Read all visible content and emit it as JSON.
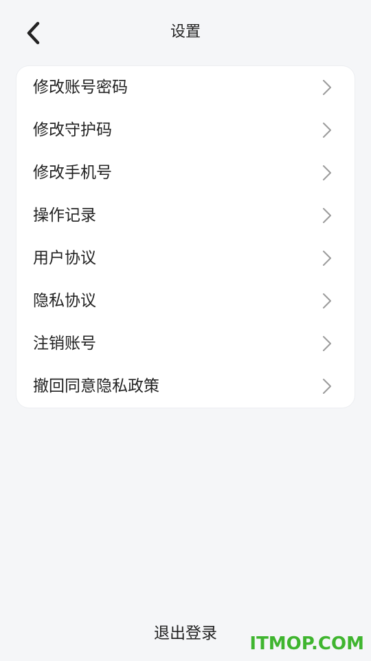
{
  "header": {
    "title": "设置",
    "back_icon": "chevron-left-icon"
  },
  "menu": {
    "items": [
      {
        "label": "修改账号密码"
      },
      {
        "label": "修改守护码"
      },
      {
        "label": "修改手机号"
      },
      {
        "label": "操作记录"
      },
      {
        "label": "用户协议"
      },
      {
        "label": "隐私协议"
      },
      {
        "label": "注销账号"
      },
      {
        "label": "撤回同意隐私政策"
      }
    ],
    "arrow_icon": "chevron-right-icon"
  },
  "footer": {
    "logout_label": "退出登录"
  },
  "watermark": {
    "text": "ITMOP.COM",
    "color": "#3fb52f"
  },
  "colors": {
    "background": "#f5f6f8",
    "card": "#ffffff",
    "text": "#222222",
    "arrow": "#9a9a9a"
  }
}
